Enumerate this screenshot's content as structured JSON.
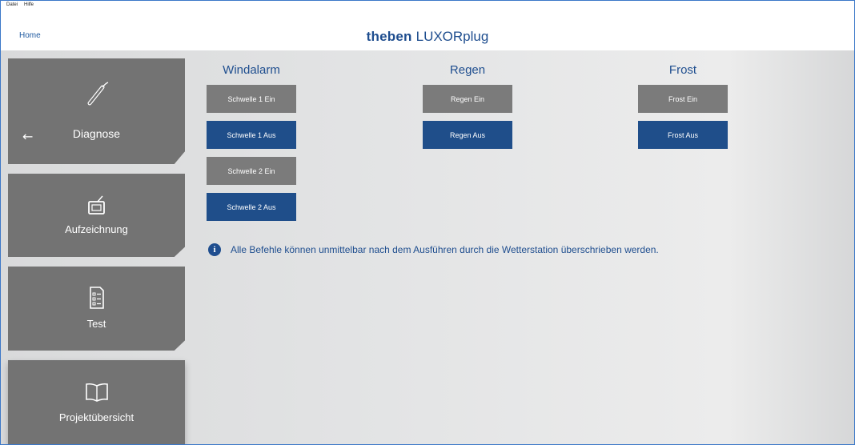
{
  "menu": {
    "file": "Datei",
    "help": "Hilfe"
  },
  "header": {
    "home": "Home",
    "brand_bold": "theben",
    "brand_light": "LUXORplug"
  },
  "nav": [
    {
      "label": "Diagnose",
      "icon": "probe-icon",
      "active": true
    },
    {
      "label": "Aufzeichnung",
      "icon": "tv-icon"
    },
    {
      "label": "Test",
      "icon": "checklist-icon"
    },
    {
      "label": "Projektübersicht",
      "icon": "book-icon"
    }
  ],
  "back_arrow": "←",
  "columns": {
    "wind": {
      "title": "Windalarm",
      "buttons": [
        "Schwelle 1 Ein",
        "Schwelle 1 Aus",
        "Schwelle 2 Ein",
        "Schwelle 2 Aus"
      ]
    },
    "rain": {
      "title": "Regen",
      "buttons": [
        "Regen Ein",
        "Regen Aus"
      ]
    },
    "frost": {
      "title": "Frost",
      "buttons": [
        "Frost Ein",
        "Frost Aus"
      ]
    }
  },
  "info": {
    "icon": "i",
    "text": "Alle Befehle können unmittelbar nach dem Ausführen durch die Wetterstation überschrieben werden."
  },
  "colors": {
    "accent": "#1f4e8f",
    "button_on": "#7b7b7b",
    "button_off": "#1f4e8a",
    "nav": "#737373"
  }
}
